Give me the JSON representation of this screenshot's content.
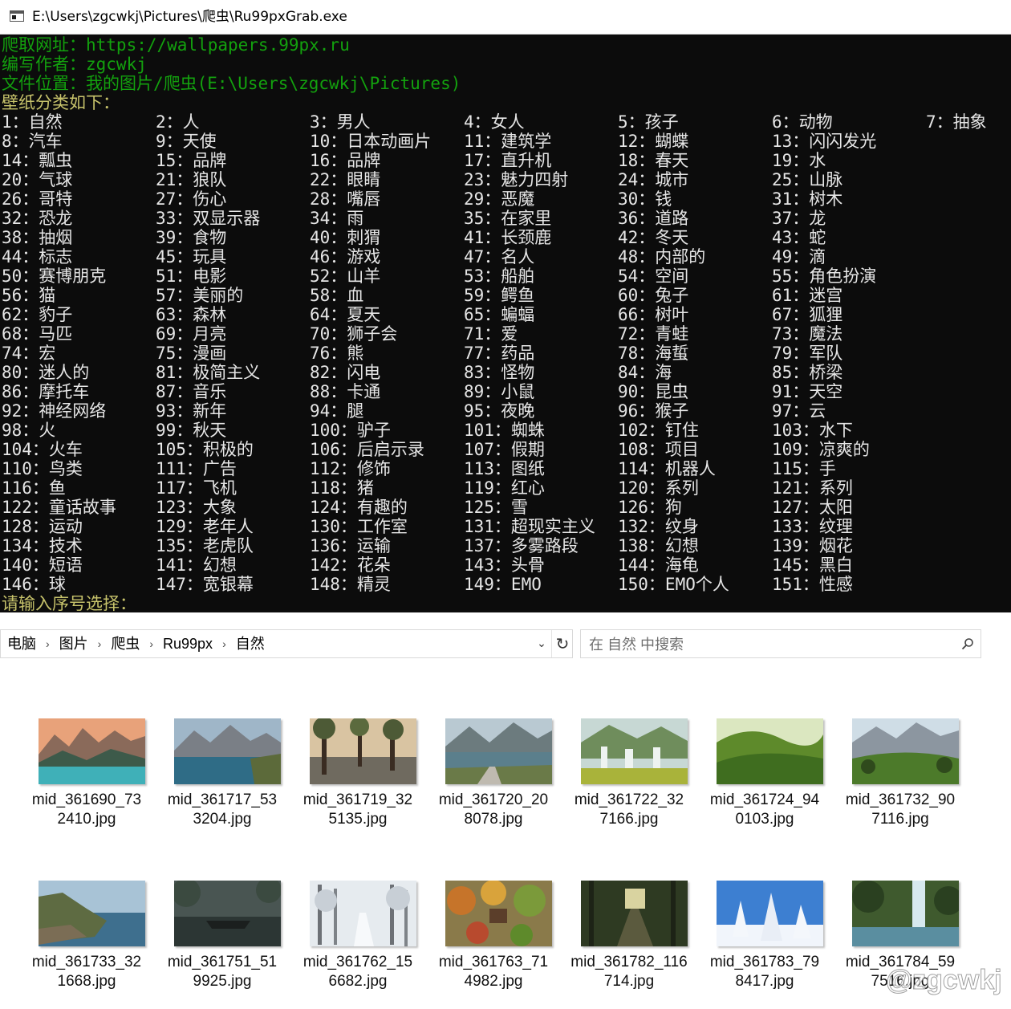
{
  "window": {
    "title": "E:\\Users\\zgcwkj\\Pictures\\爬虫\\Ru99pxGrab.exe"
  },
  "console": {
    "header": [
      {
        "text": "爬取网址：https://wallpapers.99px.ru",
        "color": "green"
      },
      {
        "text": "编写作者：zgcwkj",
        "color": "green"
      },
      {
        "text": "文件位置：我的图片/爬虫(E:\\Users\\zgcwkj\\Pictures)",
        "color": "green"
      },
      {
        "text": "壁纸分类如下：",
        "color": "yellow"
      }
    ],
    "categories": [
      [
        "1：自然",
        "2：人",
        "3：男人",
        "4：女人",
        "5：孩子",
        "6：动物",
        "7：抽象"
      ],
      [
        "8：汽车",
        "9：天使",
        "10：日本动画片",
        "11：建筑学",
        "12：蝴蝶",
        "13：闪闪发光"
      ],
      [
        "14：瓢虫",
        "15：品牌",
        "16：品牌",
        "17：直升机",
        "18：春天",
        "19：水"
      ],
      [
        "20：气球",
        "21：狼队",
        "22：眼睛",
        "23：魅力四射",
        "24：城市",
        "25：山脉"
      ],
      [
        "26：哥特",
        "27：伤心",
        "28：嘴唇",
        "29：恶魔",
        "30：钱",
        "31：树木"
      ],
      [
        "32：恐龙",
        "33：双显示器",
        "34：雨",
        "35：在家里",
        "36：道路",
        "37：龙"
      ],
      [
        "38：抽烟",
        "39：食物",
        "40：刺猬",
        "41：长颈鹿",
        "42：冬天",
        "43：蛇"
      ],
      [
        "44：标志",
        "45：玩具",
        "46：游戏",
        "47：名人",
        "48：内部的",
        "49：滴"
      ],
      [
        "50：赛博朋克",
        "51：电影",
        "52：山羊",
        "53：船舶",
        "54：空间",
        "55：角色扮演"
      ],
      [
        "56：猫",
        "57：美丽的",
        "58：血",
        "59：鳄鱼",
        "60：兔子",
        "61：迷宫"
      ],
      [
        "62：豹子",
        "63：森林",
        "64：夏天",
        "65：蝙蝠",
        "66：树叶",
        "67：狐狸"
      ],
      [
        "68：马匹",
        "69：月亮",
        "70：狮子会",
        "71：爱",
        "72：青蛙",
        "73：魔法"
      ],
      [
        "74：宏",
        "75：漫画",
        "76：熊",
        "77：药品",
        "78：海蜇",
        "79：军队"
      ],
      [
        "80：迷人的",
        "81：极简主义",
        "82：闪电",
        "83：怪物",
        "84：海",
        "85：桥梁"
      ],
      [
        "86：摩托车",
        "87：音乐",
        "88：卡通",
        "89：小鼠",
        "90：昆虫",
        "91：天空"
      ],
      [
        "92：神经网络",
        "93：新年",
        "94：腿",
        "95：夜晚",
        "96：猴子",
        "97：云"
      ],
      [
        "98：火",
        "99：秋天",
        "100：驴子",
        "101：蜘蛛",
        "102：钉住",
        "103：水下"
      ],
      [
        "104：火车",
        "105：积极的",
        "106：后启示录",
        "107：假期",
        "108：项目",
        "109：凉爽的"
      ],
      [
        "110：鸟类",
        "111：广告",
        "112：修饰",
        "113：图纸",
        "114：机器人",
        "115：手"
      ],
      [
        "116：鱼",
        "117：飞机",
        "118：猪",
        "119：红心",
        "120：系列",
        "121：系列"
      ],
      [
        "122：童话故事",
        "123：大象",
        "124：有趣的",
        "125：雪",
        "126：狗",
        "127：太阳"
      ],
      [
        "128：运动",
        "129：老年人",
        "130：工作室",
        "131：超现实主义",
        "132：纹身",
        "133：纹理"
      ],
      [
        "134：技术",
        "135：老虎队",
        "136：运输",
        "137：多雾路段",
        "138：幻想",
        "139：烟花"
      ],
      [
        "140：短语",
        "141：幻想",
        "142：花朵",
        "143：头骨",
        "144：海龟",
        "145：黑白"
      ],
      [
        "146：球",
        "147：宽银幕",
        "148：精灵",
        "149：EMO",
        "150：EMO个人",
        "151：性感"
      ]
    ],
    "prompt": "请输入序号选择：",
    "colors": {
      "background": "#0c0c0c",
      "green": "#13a10e",
      "yellow": "#c7c36b",
      "text": "#e6e6e6"
    }
  },
  "explorer": {
    "breadcrumb": [
      "电脑",
      "图片",
      "爬虫",
      "Ru99px",
      "自然"
    ],
    "search_placeholder": "在 自然 中搜索",
    "files": [
      {
        "name": "mid_361690_732410.jpg",
        "scene": "lake-mountains-sunset"
      },
      {
        "name": "mid_361717_533204.jpg",
        "scene": "alpine-lake"
      },
      {
        "name": "mid_361719_325135.jpg",
        "scene": "trees-by-water"
      },
      {
        "name": "mid_361720_208078.jpg",
        "scene": "lakeside-road"
      },
      {
        "name": "mid_361722_327166.jpg",
        "scene": "waterfalls-valley"
      },
      {
        "name": "mid_361724_940103.jpg",
        "scene": "green-hills"
      },
      {
        "name": "mid_361732_907116.jpg",
        "scene": "mountain-meadow"
      },
      {
        "name": "mid_361733_321668.jpg",
        "scene": "coastal-cliffs"
      },
      {
        "name": "mid_361751_519925.jpg",
        "scene": "boat-in-fog"
      },
      {
        "name": "mid_361762_156682.jpg",
        "scene": "snowy-forest-path"
      },
      {
        "name": "mid_361763_714982.jpg",
        "scene": "autumn-garden"
      },
      {
        "name": "mid_361782_116714.jpg",
        "scene": "forest-road"
      },
      {
        "name": "mid_361783_798417.jpg",
        "scene": "snow-covered-trees"
      },
      {
        "name": "mid_361784_597516.jpg",
        "scene": "jungle-waterfall"
      }
    ]
  },
  "watermark": "@zgcwkj"
}
